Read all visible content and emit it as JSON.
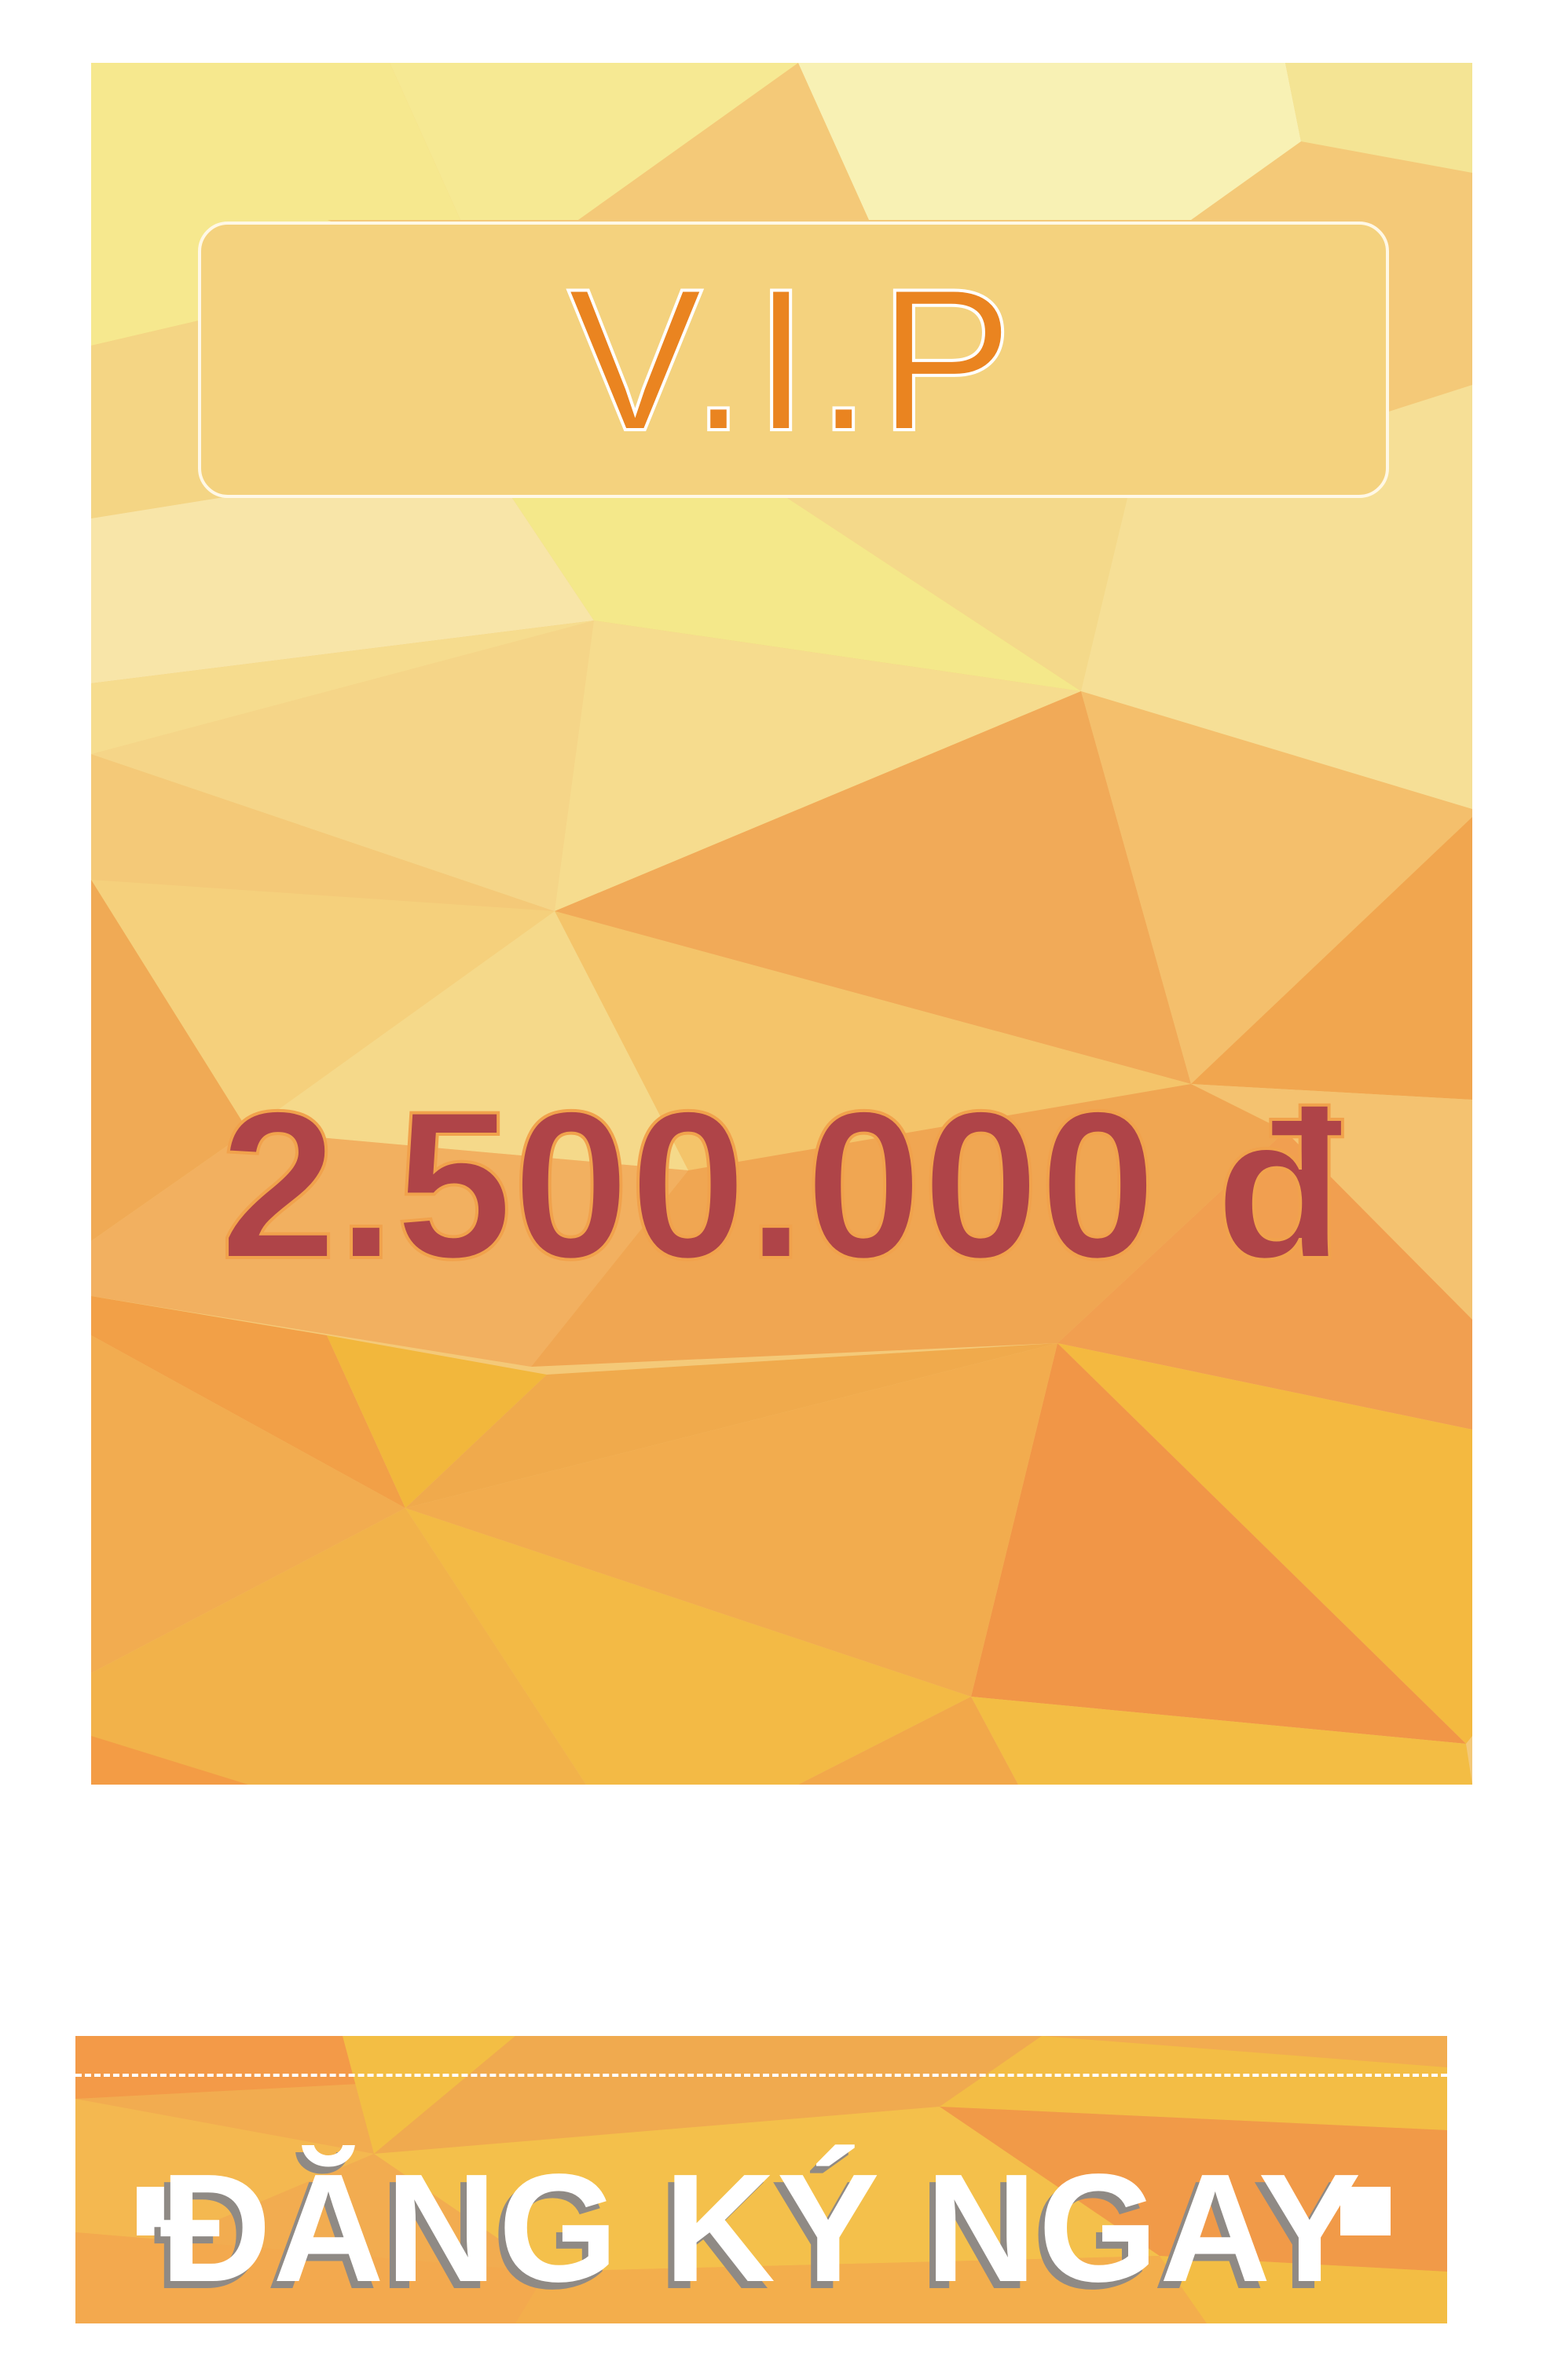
{
  "card": {
    "title": "V.I.P",
    "price": "2.500.000 đ"
  },
  "cta": {
    "label": "ĐĂNG KÝ NGAY"
  },
  "colors": {
    "title_text": "#ea8420",
    "title_box": "#f4d27e",
    "price_text": "#af4448",
    "price_outline": "#f1a24c",
    "cta_text": "#ffffff"
  }
}
